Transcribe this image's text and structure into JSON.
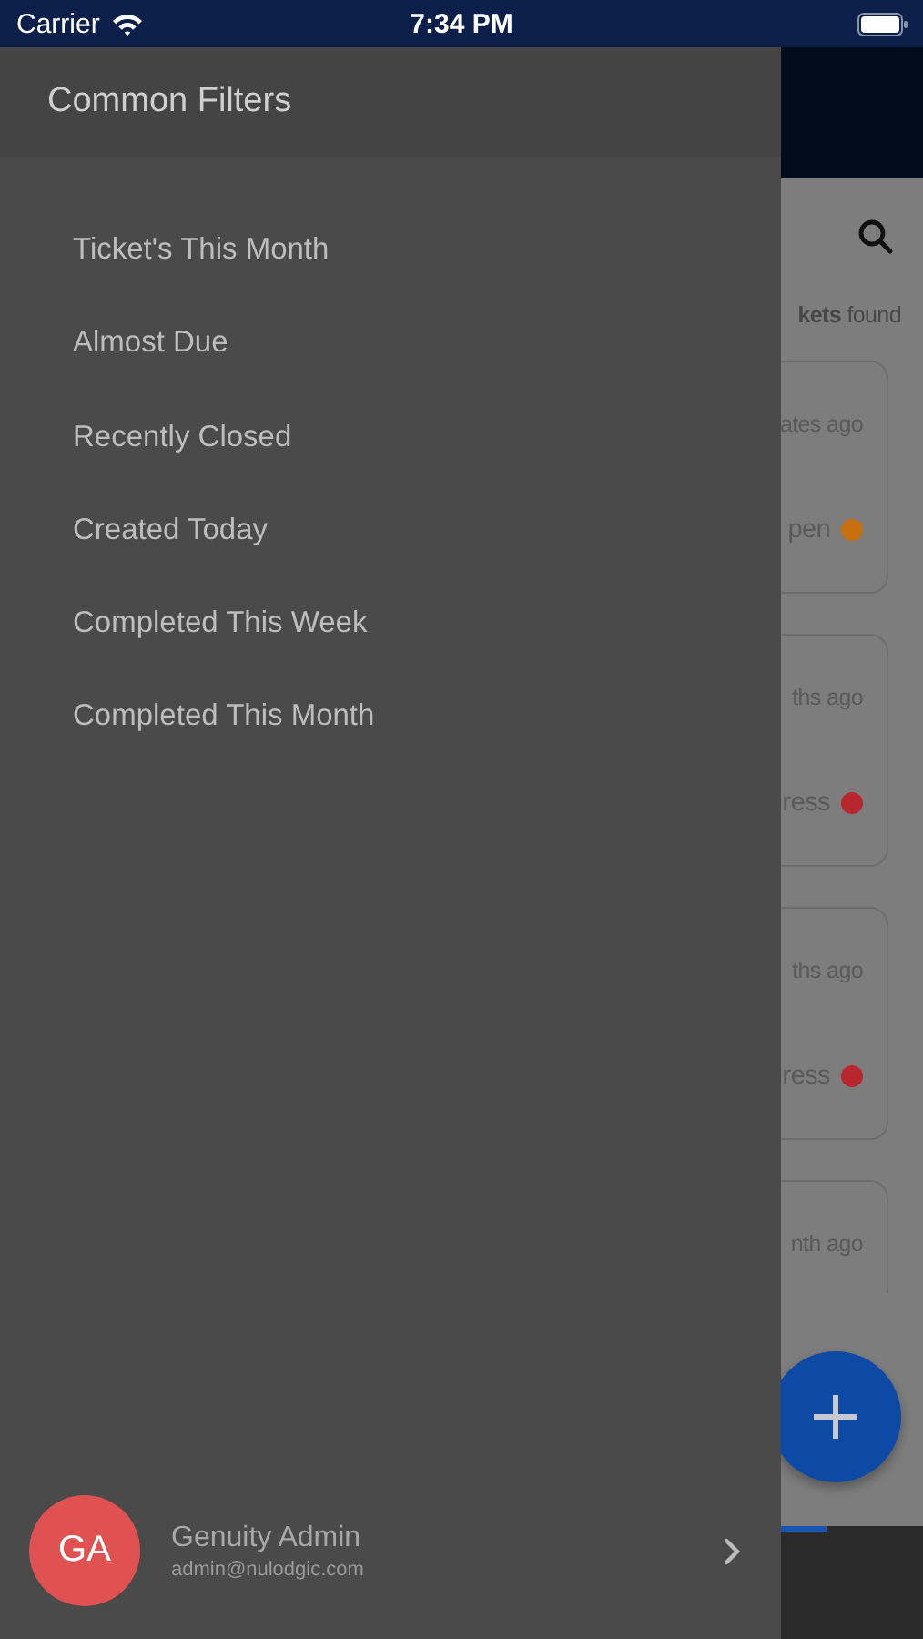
{
  "status_bar": {
    "carrier": "Carrier",
    "time": "7:34 PM"
  },
  "drawer": {
    "title": "Common Filters",
    "items": [
      {
        "label": "Ticket's This Month"
      },
      {
        "label": "Almost Due"
      },
      {
        "label": "Recently Closed"
      },
      {
        "label": "Created Today"
      },
      {
        "label": "Completed This Week"
      },
      {
        "label": "Completed This Month"
      }
    ],
    "user": {
      "initials": "GA",
      "name": "Genuity Admin",
      "email": "admin@nulodgic.com"
    }
  },
  "background": {
    "result_text": "**kets** found",
    "cards": [
      {
        "time": "ates ago",
        "status": "pen",
        "color": "#c8700f"
      },
      {
        "time": "ths ago",
        "status": "ress",
        "color": "#b8262e"
      },
      {
        "time": "ths ago",
        "status": "ress",
        "color": "#b8262e"
      },
      {
        "time": "nth ago"
      }
    ]
  }
}
